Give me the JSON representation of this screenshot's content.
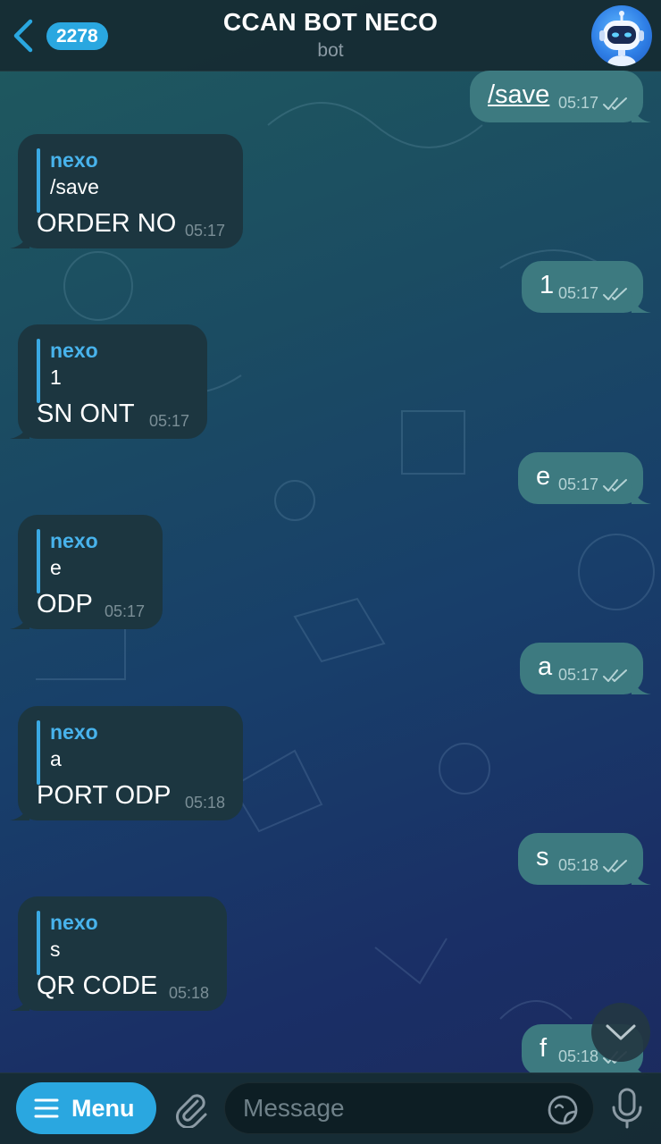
{
  "header": {
    "unread_count": "2278",
    "title": "CCAN BOT NECO",
    "subtitle": "bot"
  },
  "messages": [
    {
      "dir": "out",
      "text": "/save",
      "time": "05:17",
      "link": true
    },
    {
      "dir": "in",
      "reply_name": "nexo",
      "reply_text": "/save",
      "text": "ORDER NO",
      "time": "05:17"
    },
    {
      "dir": "out",
      "text": "1",
      "time": "05:17"
    },
    {
      "dir": "in",
      "reply_name": "nexo",
      "reply_text": "1",
      "text": "SN ONT",
      "time": "05:17"
    },
    {
      "dir": "out",
      "text": "e",
      "time": "05:17"
    },
    {
      "dir": "in",
      "reply_name": "nexo",
      "reply_text": "e",
      "text": "ODP",
      "time": "05:17"
    },
    {
      "dir": "out",
      "text": "a",
      "time": "05:17"
    },
    {
      "dir": "in",
      "reply_name": "nexo",
      "reply_text": "a",
      "text": "PORT ODP",
      "time": "05:18"
    },
    {
      "dir": "out",
      "text": "s",
      "time": "05:18"
    },
    {
      "dir": "in",
      "reply_name": "nexo",
      "reply_text": "s",
      "text": "QR CODE",
      "time": "05:18"
    },
    {
      "dir": "out",
      "text": "f",
      "time": "05:18"
    }
  ],
  "input_bar": {
    "menu_label": "Menu",
    "placeholder": "Message"
  },
  "icons": {
    "back": "chevron-left-icon",
    "avatar": "robot-avatar-icon",
    "menu": "hamburger-icon",
    "attach": "paperclip-icon",
    "sticker": "sticker-icon",
    "mic": "microphone-icon",
    "scroll": "chevron-down-icon",
    "read": "double-check-icon"
  },
  "colors": {
    "accent": "#2aa7e0",
    "outgoing_bubble": "#3d7a80",
    "incoming_bubble": "#1c3640",
    "reply_name": "#48b3ec"
  }
}
